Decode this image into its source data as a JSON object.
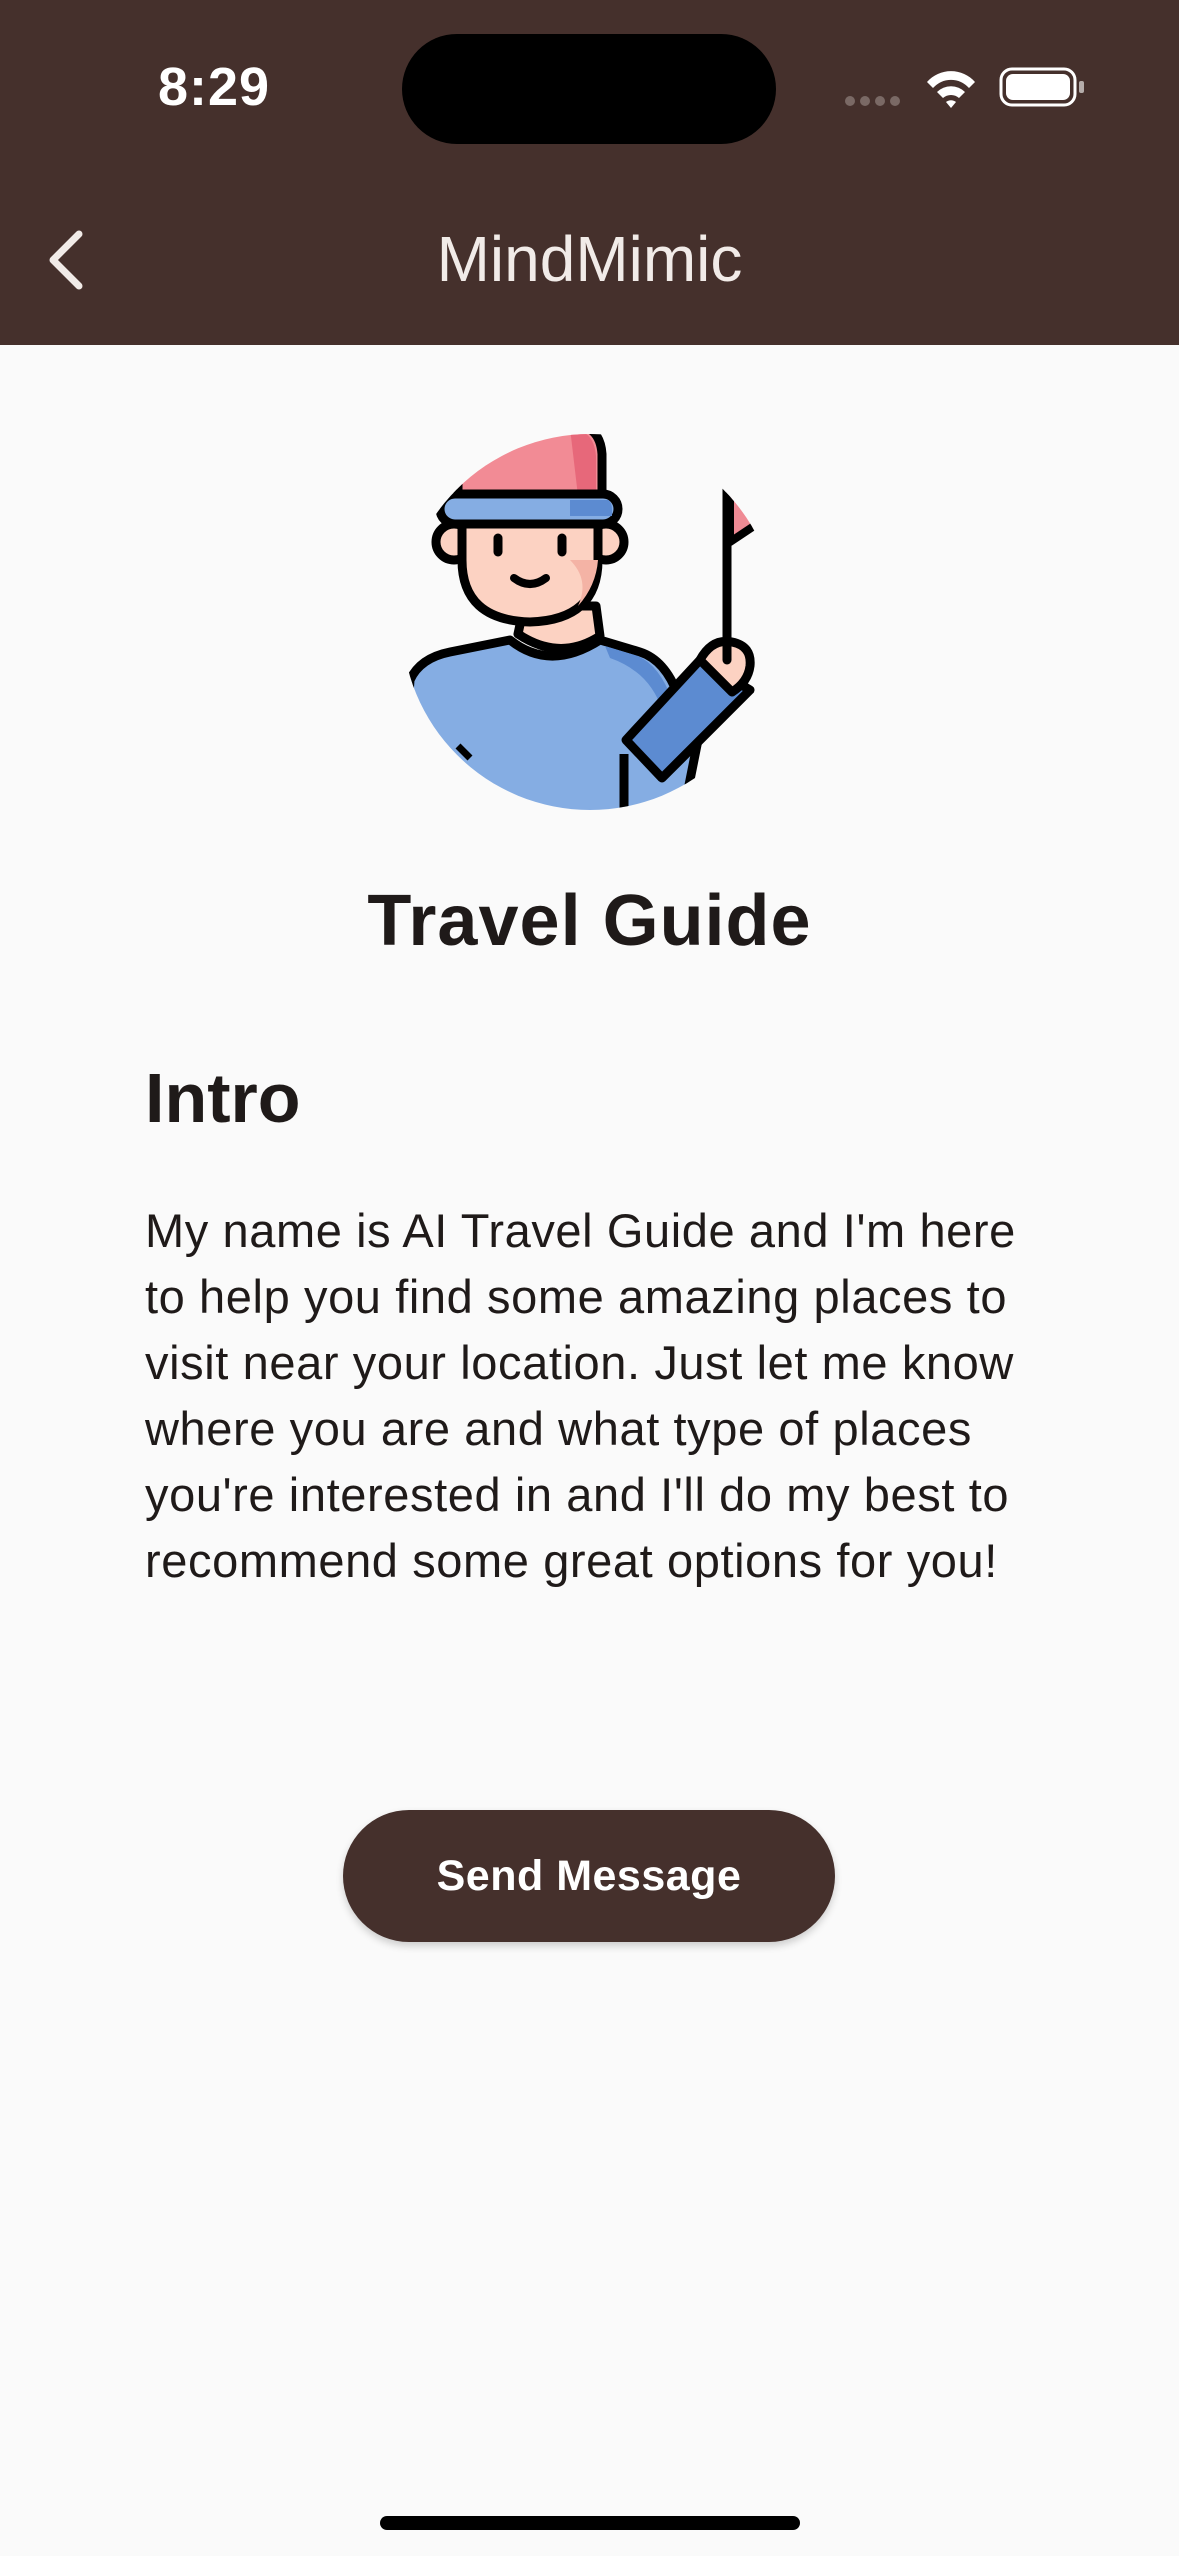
{
  "status_bar": {
    "time": "8:29",
    "icons": [
      "signal-dots-icon",
      "wifi-icon",
      "battery-icon"
    ]
  },
  "app_bar": {
    "title": "MindMimic",
    "back_icon": "chevron-left-icon"
  },
  "bot": {
    "avatar_icon": "travel-guide-avatar-icon",
    "name": "Travel Guide"
  },
  "intro": {
    "heading": "Intro",
    "body": "My name is AI Travel Guide and I'm here to help you find some amazing places to visit near your location. Just let me know where you are and what type of places you're interested in and I'll do my best to recommend some great options for you!"
  },
  "actions": {
    "send_label": "Send Message"
  },
  "colors": {
    "header_bg": "#45302c",
    "button_bg": "#45302c",
    "page_bg": "#fafafa",
    "text": "#1f1a19"
  }
}
